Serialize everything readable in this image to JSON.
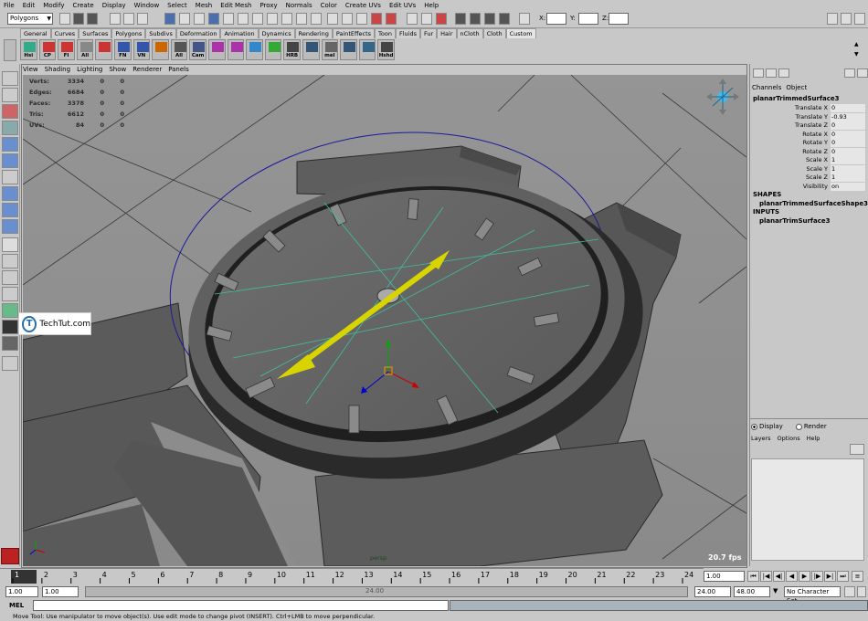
{
  "menubar": [
    "File",
    "Edit",
    "Modify",
    "Create",
    "Display",
    "Window",
    "Select",
    "Mesh",
    "Edit Mesh",
    "Proxy",
    "Normals",
    "Color",
    "Create UVs",
    "Edit UVs",
    "Help"
  ],
  "statusline": {
    "menuset": "Polygons",
    "x_label": "X:",
    "y_label": "Y:",
    "z_label": "Z:"
  },
  "shelf": {
    "tabs": [
      "General",
      "Curves",
      "Surfaces",
      "Polygons",
      "Subdivs",
      "Deformation",
      "Animation",
      "Dynamics",
      "Rendering",
      "PaintEffects",
      "Toon",
      "Fluids",
      "Fur",
      "Hair",
      "nCloth",
      "Cloth",
      "Custom"
    ],
    "active_tab": "Custom",
    "buttons": [
      "Hsi",
      "CP",
      "FI",
      "All",
      "",
      "FN",
      "VN",
      "",
      "All",
      "Cam",
      "",
      "",
      "",
      "",
      "HRB",
      "",
      "mel",
      "",
      "",
      "Hshd"
    ]
  },
  "viewport": {
    "panel_menu": [
      "View",
      "Shading",
      "Lighting",
      "Show",
      "Renderer",
      "Panels"
    ],
    "hud": [
      {
        "label": "Verts:",
        "value": "3334",
        "a": "0",
        "b": "0"
      },
      {
        "label": "Edges:",
        "value": "6684",
        "a": "0",
        "b": "0"
      },
      {
        "label": "Faces:",
        "value": "3378",
        "a": "0",
        "b": "0"
      },
      {
        "label": "Tris:",
        "value": "6612",
        "a": "0",
        "b": "0"
      },
      {
        "label": "UVs:",
        "value": "84",
        "a": "0",
        "b": "0"
      }
    ],
    "camera": "persp",
    "fps": "20.7 fps"
  },
  "watermark": {
    "letter": "T",
    "text": "TechTut.com"
  },
  "channelbox": {
    "tabs": [
      "Channels",
      "Object"
    ],
    "object": "planarTrimmedSurface3",
    "attributes": [
      {
        "name": "Translate X",
        "value": "0"
      },
      {
        "name": "Translate Y",
        "value": "-0.93"
      },
      {
        "name": "Translate Z",
        "value": "0"
      },
      {
        "name": "Rotate X",
        "value": "0"
      },
      {
        "name": "Rotate Y",
        "value": "0"
      },
      {
        "name": "Rotate Z",
        "value": "0"
      },
      {
        "name": "Scale X",
        "value": "1"
      },
      {
        "name": "Scale Y",
        "value": "1"
      },
      {
        "name": "Scale Z",
        "value": "1"
      },
      {
        "name": "Visibility",
        "value": "on"
      }
    ],
    "shapes_header": "SHAPES",
    "shape": "planarTrimmedSurfaceShape3",
    "inputs_header": "INPUTS",
    "input": "planarTrimSurface3"
  },
  "layers": {
    "radio_display": "Display",
    "radio_render": "Render",
    "menu": [
      "Layers",
      "Options",
      "Help"
    ]
  },
  "timeslider": {
    "ticks": [
      "1",
      "2",
      "3",
      "4",
      "5",
      "6",
      "7",
      "8",
      "9",
      "10",
      "11",
      "12",
      "13",
      "14",
      "15",
      "16",
      "17",
      "18",
      "19",
      "20",
      "21",
      "22",
      "23",
      "24"
    ],
    "current_frame": "1.00"
  },
  "range": {
    "start_time": "1.00",
    "playback_start": "1.00",
    "bar_label": "24.00",
    "playback_end": "24.00",
    "end_time": "48.00",
    "character_set": "No Character Set"
  },
  "commandline": {
    "label": "MEL"
  },
  "helpline": "Move Tool: Use manipulator to move object(s). Use edit mode to change pivot (INSERT). Ctrl+LMB to move perpendicular."
}
